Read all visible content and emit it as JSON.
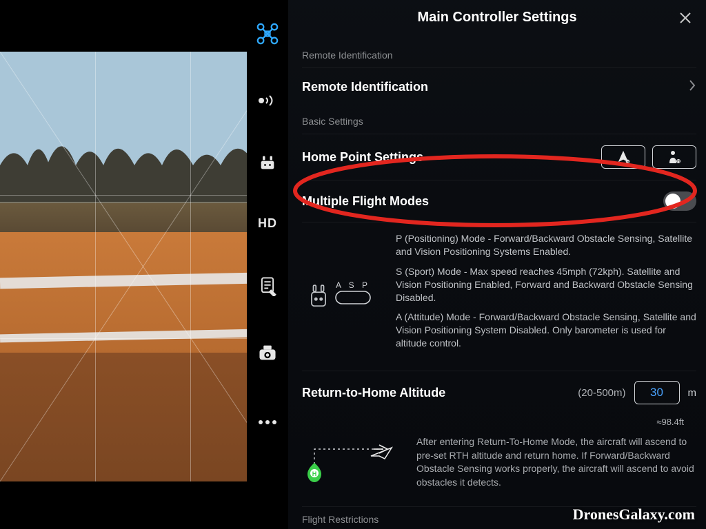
{
  "panel": {
    "title": "Main Controller Settings",
    "sections": {
      "remote_id_header": "Remote Identification",
      "remote_id_row": "Remote Identification",
      "basic_header": "Basic Settings",
      "home_point": "Home Point Settings",
      "multi_flight": "Multiple Flight Modes",
      "rth_label": "Return-to-Home Altitude",
      "rth_range": "(20-500m)",
      "rth_value": "30",
      "rth_unit": "m",
      "rth_approx": "≈98.4ft",
      "flight_restrictions": "Flight Restrictions"
    },
    "mode_switch_letters": "A S P",
    "mode_text": {
      "p": "P (Positioning) Mode - Forward/Backward Obstacle Sensing, Satellite and Vision Positioning Systems Enabled.",
      "s": "S (Sport) Mode - Max speed reaches 45mph (72kph). Satellite and Vision Positioning Enabled, Forward and Backward Obstacle Sensing Disabled.",
      "a": "A (Attitude) Mode - Forward/Backward Obstacle Sensing, Satellite and Vision Positioning System Disabled. Only barometer is used for altitude control."
    },
    "rth_desc": "After entering Return-To-Home Mode, the aircraft will ascend to pre-set RTH altitude and return home. If Forward/Backward Obstacle Sensing works properly, the aircraft will ascend to avoid obstacles it detects."
  },
  "multi_flight_toggle": false,
  "watermark": "DronesGalaxy.com"
}
